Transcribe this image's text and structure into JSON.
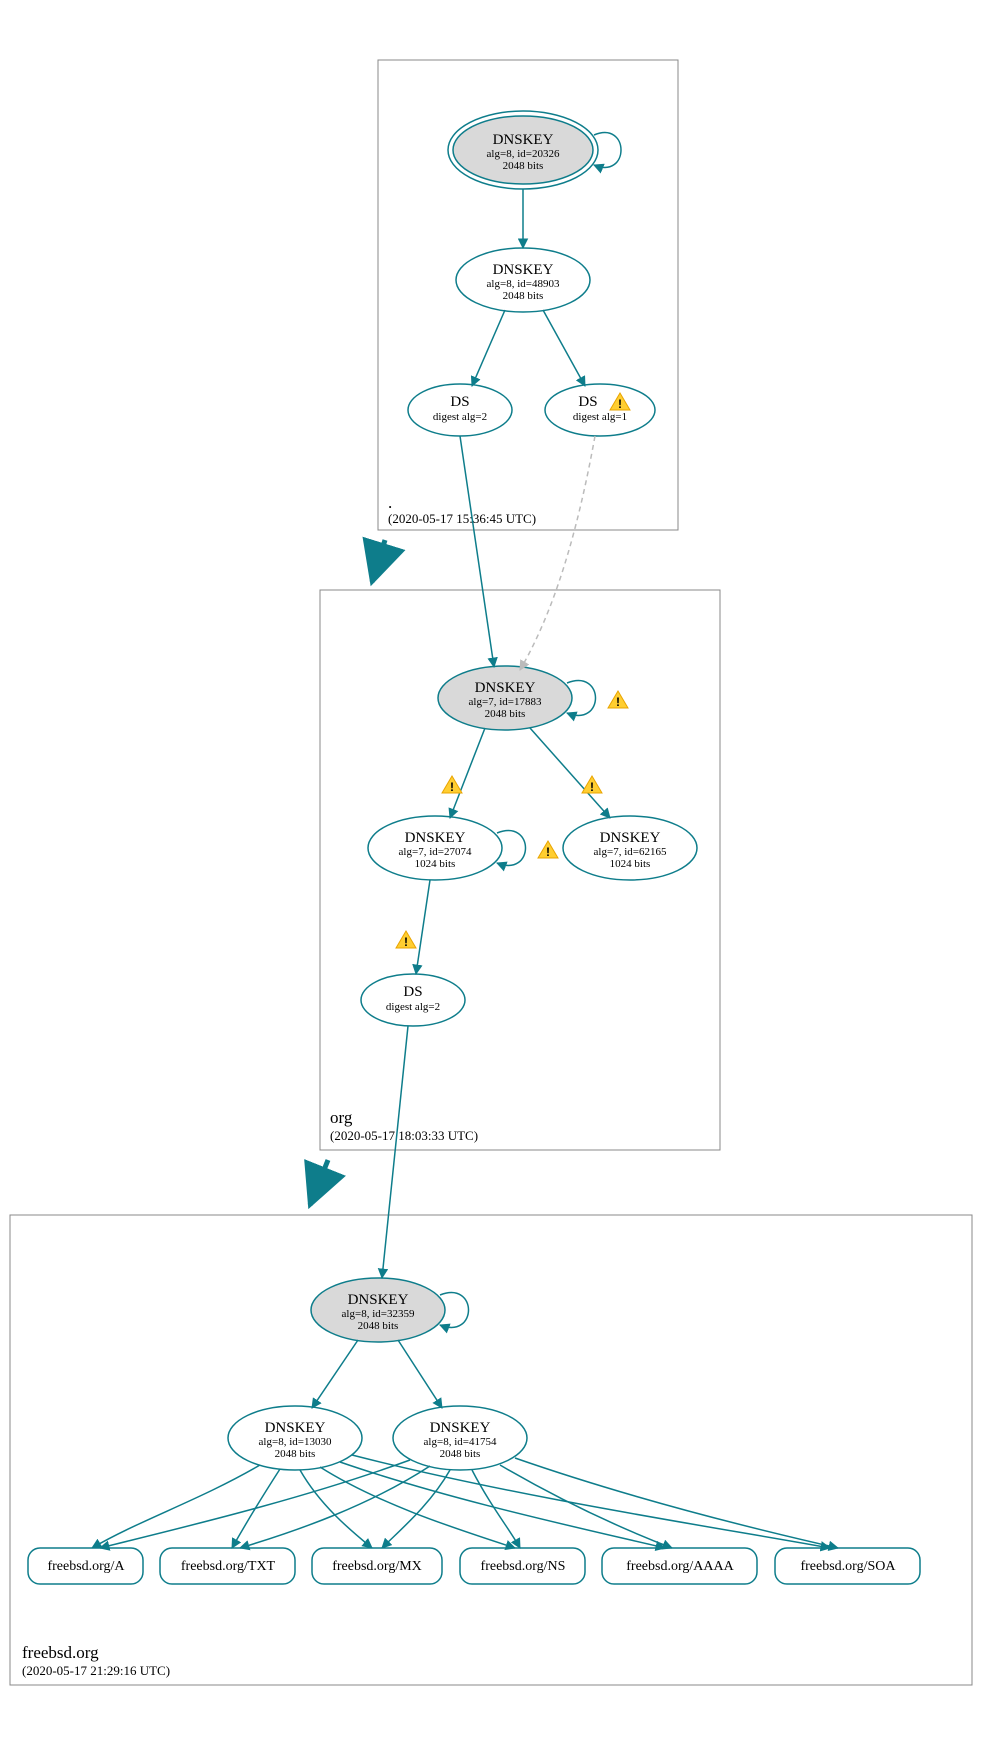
{
  "colors": {
    "stroke": "#0E7D8B",
    "arrow": "#0E7D8B",
    "zone_border": "#888888",
    "ksk_fill": "#d9d9d9",
    "dashed": "#bbbbbb"
  },
  "zones": {
    "root": {
      "label": ".",
      "timestamp": "(2020-05-17 15:36:45 UTC)"
    },
    "org": {
      "label": "org",
      "timestamp": "(2020-05-17 18:03:33 UTC)"
    },
    "freebsd": {
      "label": "freebsd.org",
      "timestamp": "(2020-05-17 21:29:16 UTC)"
    }
  },
  "nodes": {
    "root_ksk": {
      "title": "DNSKEY",
      "line1": "alg=8, id=20326",
      "line2": "2048 bits"
    },
    "root_zsk": {
      "title": "DNSKEY",
      "line1": "alg=8, id=48903",
      "line2": "2048 bits"
    },
    "root_ds1": {
      "title": "DS",
      "line1": "digest alg=2"
    },
    "root_ds2": {
      "title": "DS",
      "line1": "digest alg=1"
    },
    "org_ksk": {
      "title": "DNSKEY",
      "line1": "alg=7, id=17883",
      "line2": "2048 bits"
    },
    "org_zsk1": {
      "title": "DNSKEY",
      "line1": "alg=7, id=27074",
      "line2": "1024 bits"
    },
    "org_zsk2": {
      "title": "DNSKEY",
      "line1": "alg=7, id=62165",
      "line2": "1024 bits"
    },
    "org_ds": {
      "title": "DS",
      "line1": "digest alg=2"
    },
    "fbsd_ksk": {
      "title": "DNSKEY",
      "line1": "alg=8, id=32359",
      "line2": "2048 bits"
    },
    "fbsd_zsk1": {
      "title": "DNSKEY",
      "line1": "alg=8, id=13030",
      "line2": "2048 bits"
    },
    "fbsd_zsk2": {
      "title": "DNSKEY",
      "line1": "alg=8, id=41754",
      "line2": "2048 bits"
    }
  },
  "rrsets": {
    "a": "freebsd.org/A",
    "txt": "freebsd.org/TXT",
    "mx": "freebsd.org/MX",
    "ns": "freebsd.org/NS",
    "aaaa": "freebsd.org/AAAA",
    "soa": "freebsd.org/SOA"
  }
}
